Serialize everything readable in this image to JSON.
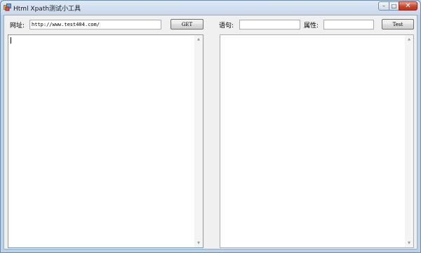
{
  "window": {
    "title": "Html Xpath测试小工具",
    "minimize_glyph": "–",
    "maximize_glyph": "□",
    "close_glyph": "✕"
  },
  "toolbar": {
    "url_label": "网址:",
    "url_value": "http://www.test404.com/",
    "get_button": "GET",
    "statement_label": "语句:",
    "statement_value": "",
    "attribute_label": "属性:",
    "attribute_value": "",
    "test_button": "Test"
  },
  "panes": {
    "left": {
      "content": ""
    },
    "right": {
      "content": ""
    },
    "scroll_up_glyph": "▲",
    "scroll_down_glyph": "▼"
  },
  "colors": {
    "title_gradient_top": "#dfe9f5",
    "client_background": "#f0f0f0",
    "close_button": "#c74531",
    "focused_border": "#7a9cc8"
  },
  "icons": {
    "app": "app-icon",
    "minimize": "minimize-icon",
    "maximize": "maximize-icon",
    "close": "close-icon"
  }
}
